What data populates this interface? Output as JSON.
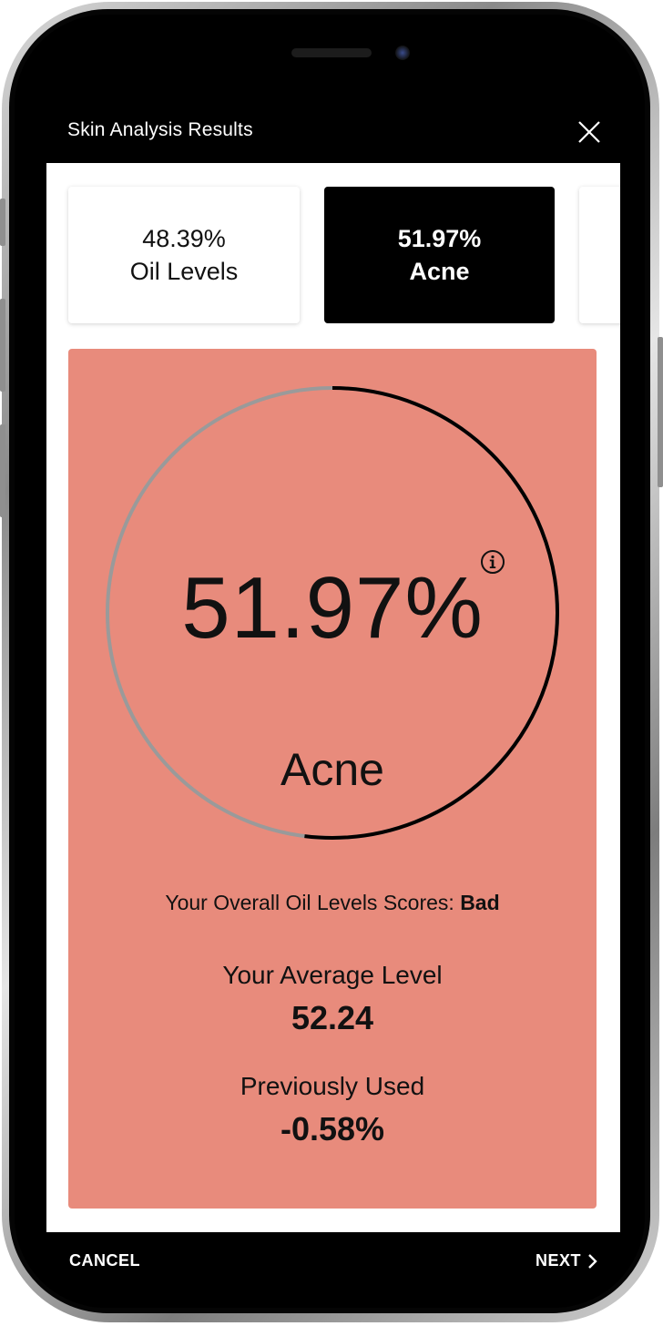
{
  "header": {
    "title": "Skin Analysis Results"
  },
  "tabs": [
    {
      "value": "48.39%",
      "label": "Oil Levels"
    },
    {
      "value": "51.97%",
      "label": "Acne"
    }
  ],
  "result": {
    "value": "51.97%",
    "label": "Acne",
    "progress_fraction": 0.5197,
    "card_color": "#e88b7c",
    "ring_track_color": "#9a9a9a",
    "ring_fill_color": "#000000"
  },
  "score": {
    "prefix": "Your Overall Oil Levels Scores:",
    "rating": "Bad"
  },
  "average": {
    "label": "Your Average Level",
    "value": "52.24"
  },
  "previous": {
    "label": "Previously Used",
    "value": "-0.58%"
  },
  "footer": {
    "cancel_label": "CANCEL",
    "next_label": "NEXT"
  },
  "icons": {
    "close": "close-icon",
    "info": "info-icon",
    "next": "chevron-right-icon"
  }
}
